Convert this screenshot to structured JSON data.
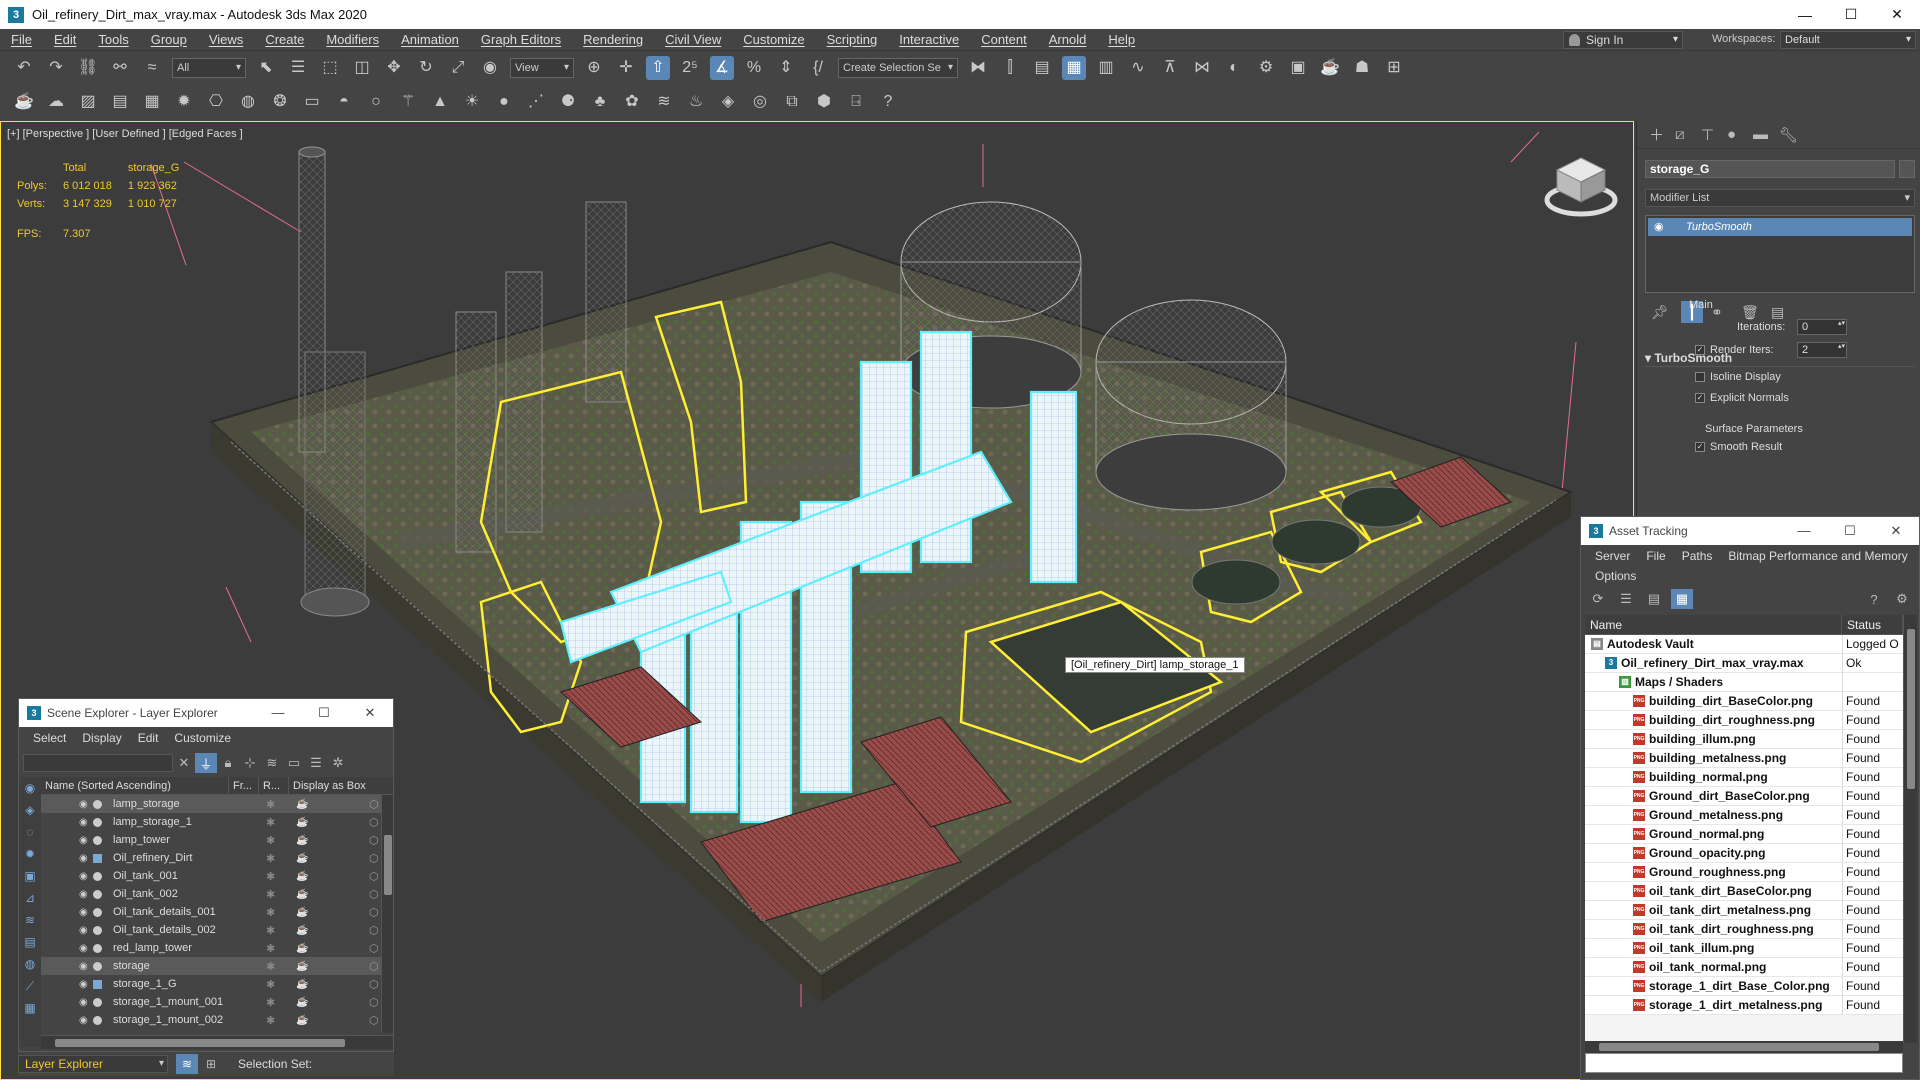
{
  "window": {
    "title": "Oil_refinery_Dirt_max_vray.max - Autodesk 3ds Max 2020"
  },
  "menubar": {
    "items": [
      "File",
      "Edit",
      "Tools",
      "Group",
      "Views",
      "Create",
      "Modifiers",
      "Animation",
      "Graph Editors",
      "Rendering",
      "Civil View",
      "Customize",
      "Scripting",
      "Interactive",
      "Content",
      "Arnold",
      "Help"
    ]
  },
  "account": {
    "sign_in": "Sign In",
    "workspaces_label": "Workspaces:",
    "workspace": "Default"
  },
  "toolbar": {
    "filter": "All",
    "ref_coord": "View",
    "selection_set": "Create Selection Se"
  },
  "viewport": {
    "label": "[+] [Perspective ] [User Defined ] [Edged Faces ]",
    "stats": {
      "col_total": "Total",
      "col_sel": "storage_G",
      "polys_label": "Polys:",
      "polys_total": "6 012 018",
      "polys_sel": "1 923 362",
      "verts_label": "Verts:",
      "verts_total": "3 147 329",
      "verts_sel": "1 010 727",
      "fps_label": "FPS:",
      "fps": "7.307"
    },
    "tooltip": "[Oil_refinery_Dirt] lamp_storage_1"
  },
  "command_panel": {
    "object_name": "storage_G",
    "modifier_list": "Modifier List",
    "modifier_stack": [
      "TurboSmooth"
    ],
    "rollout": {
      "title": "TurboSmooth",
      "main_label": "Main",
      "iterations_label": "Iterations:",
      "iterations": "0",
      "render_iters_label": "Render Iters:",
      "render_iters": "2",
      "isoline": "Isoline Display",
      "explicit_normals": "Explicit Normals",
      "surface_label": "Surface Parameters",
      "smooth_result": "Smooth Result"
    }
  },
  "scene_explorer": {
    "title": "Scene Explorer - Layer Explorer",
    "menu": [
      "Select",
      "Display",
      "Edit",
      "Customize"
    ],
    "columns": [
      "Name (Sorted Ascending)",
      "Fr...",
      "R...",
      "Display as Box"
    ],
    "rows": [
      {
        "name": "lamp_storage",
        "selected": true,
        "group": false
      },
      {
        "name": "lamp_storage_1",
        "selected": false,
        "group": false
      },
      {
        "name": "lamp_tower",
        "selected": false,
        "group": false
      },
      {
        "name": "Oil_refinery_Dirt",
        "selected": false,
        "group": true
      },
      {
        "name": "Oil_tank_001",
        "selected": false,
        "group": false
      },
      {
        "name": "Oil_tank_002",
        "selected": false,
        "group": false
      },
      {
        "name": "Oil_tank_details_001",
        "selected": false,
        "group": false
      },
      {
        "name": "Oil_tank_details_002",
        "selected": false,
        "group": false
      },
      {
        "name": "red_lamp_tower",
        "selected": false,
        "group": false
      },
      {
        "name": "storage",
        "selected": true,
        "group": false
      },
      {
        "name": "storage_1_G",
        "selected": false,
        "group": true
      },
      {
        "name": "storage_1_mount_001",
        "selected": false,
        "group": false
      },
      {
        "name": "storage_1_mount_002",
        "selected": false,
        "group": false
      }
    ],
    "footer": {
      "explorer": "Layer Explorer",
      "selection_set": "Selection Set:"
    }
  },
  "asset_tracking": {
    "title": "Asset Tracking",
    "menu": [
      "Server",
      "File",
      "Paths",
      "Bitmap Performance and Memory"
    ],
    "menu2": [
      "Options"
    ],
    "columns": [
      "Name",
      "Status"
    ],
    "rows": [
      {
        "name": "Autodesk Vault",
        "status": "Logged O",
        "level": 0,
        "kind": "vault"
      },
      {
        "name": "Oil_refinery_Dirt_max_vray.max",
        "status": "Ok",
        "level": 1,
        "kind": "max"
      },
      {
        "name": "Maps / Shaders",
        "status": "",
        "level": 2,
        "kind": "maps"
      },
      {
        "name": "building_dirt_BaseColor.png",
        "status": "Found",
        "level": 3,
        "kind": "png"
      },
      {
        "name": "building_dirt_roughness.png",
        "status": "Found",
        "level": 3,
        "kind": "png"
      },
      {
        "name": "building_illum.png",
        "status": "Found",
        "level": 3,
        "kind": "png"
      },
      {
        "name": "building_metalness.png",
        "status": "Found",
        "level": 3,
        "kind": "png"
      },
      {
        "name": "building_normal.png",
        "status": "Found",
        "level": 3,
        "kind": "png"
      },
      {
        "name": "Ground_dirt_BaseColor.png",
        "status": "Found",
        "level": 3,
        "kind": "png"
      },
      {
        "name": "Ground_metalness.png",
        "status": "Found",
        "level": 3,
        "kind": "png"
      },
      {
        "name": "Ground_normal.png",
        "status": "Found",
        "level": 3,
        "kind": "png"
      },
      {
        "name": "Ground_opacity.png",
        "status": "Found",
        "level": 3,
        "kind": "png"
      },
      {
        "name": "Ground_roughness.png",
        "status": "Found",
        "level": 3,
        "kind": "png"
      },
      {
        "name": "oil_tank_dirt_BaseColor.png",
        "status": "Found",
        "level": 3,
        "kind": "png"
      },
      {
        "name": "oil_tank_dirt_metalness.png",
        "status": "Found",
        "level": 3,
        "kind": "png"
      },
      {
        "name": "oil_tank_dirt_roughness.png",
        "status": "Found",
        "level": 3,
        "kind": "png"
      },
      {
        "name": "oil_tank_illum.png",
        "status": "Found",
        "level": 3,
        "kind": "png"
      },
      {
        "name": "oil_tank_normal.png",
        "status": "Found",
        "level": 3,
        "kind": "png"
      },
      {
        "name": "storage_1_dirt_Base_Color.png",
        "status": "Found",
        "level": 3,
        "kind": "png"
      },
      {
        "name": "storage_1_dirt_metalness.png",
        "status": "Found",
        "level": 3,
        "kind": "png"
      }
    ]
  },
  "colors": {
    "accent": "#5a87b5",
    "yellow_select": "#ffee33",
    "cyan_select": "#5ef0ff",
    "stats": "#f0c830"
  }
}
